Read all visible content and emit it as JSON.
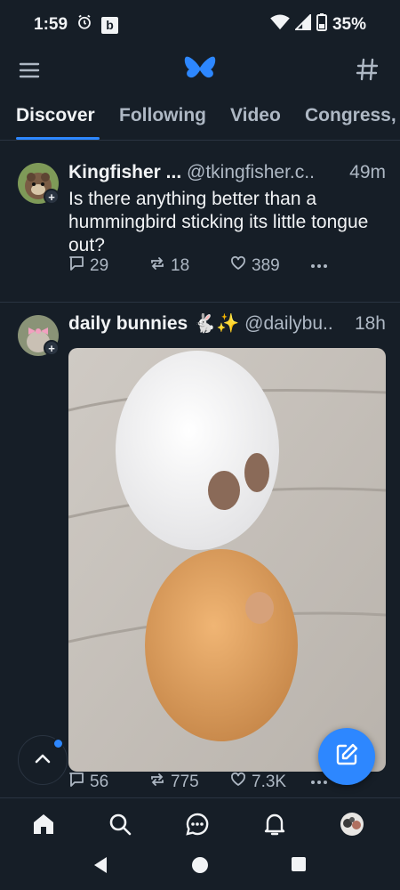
{
  "status_bar": {
    "time": "1:59",
    "badge": "b",
    "battery": "35%"
  },
  "tabs": [
    {
      "label": "Discover",
      "active": true
    },
    {
      "label": "Following",
      "active": false
    },
    {
      "label": "Video",
      "active": false
    },
    {
      "label": "Congress,",
      "active": false
    }
  ],
  "posts": [
    {
      "author": "Kingfisher ...",
      "handle": "@tkingfisher.c..",
      "time": "49m",
      "text": "Is there anything better than a hummingbird sticking its little tongue out?",
      "replies": "29",
      "reposts": "18",
      "likes": "389"
    },
    {
      "author": "daily bunnies 🐇✨",
      "handle": "@dailybu..",
      "time": "18h",
      "image_description": "white and orange hamster-like bunnies on a couch",
      "replies": "56",
      "reposts": "775",
      "likes": "7.3K"
    }
  ],
  "colors": {
    "accent": "#2d87ff",
    "background": "#161e27",
    "muted": "#aeb8c4",
    "divider": "#2a3441"
  },
  "icons": {
    "top_bar": [
      "menu-icon",
      "butterfly-logo-icon",
      "hash-icon"
    ],
    "bottom_nav": [
      "home-icon",
      "search-icon",
      "chat-icon",
      "bell-icon",
      "profile-avatar"
    ]
  }
}
